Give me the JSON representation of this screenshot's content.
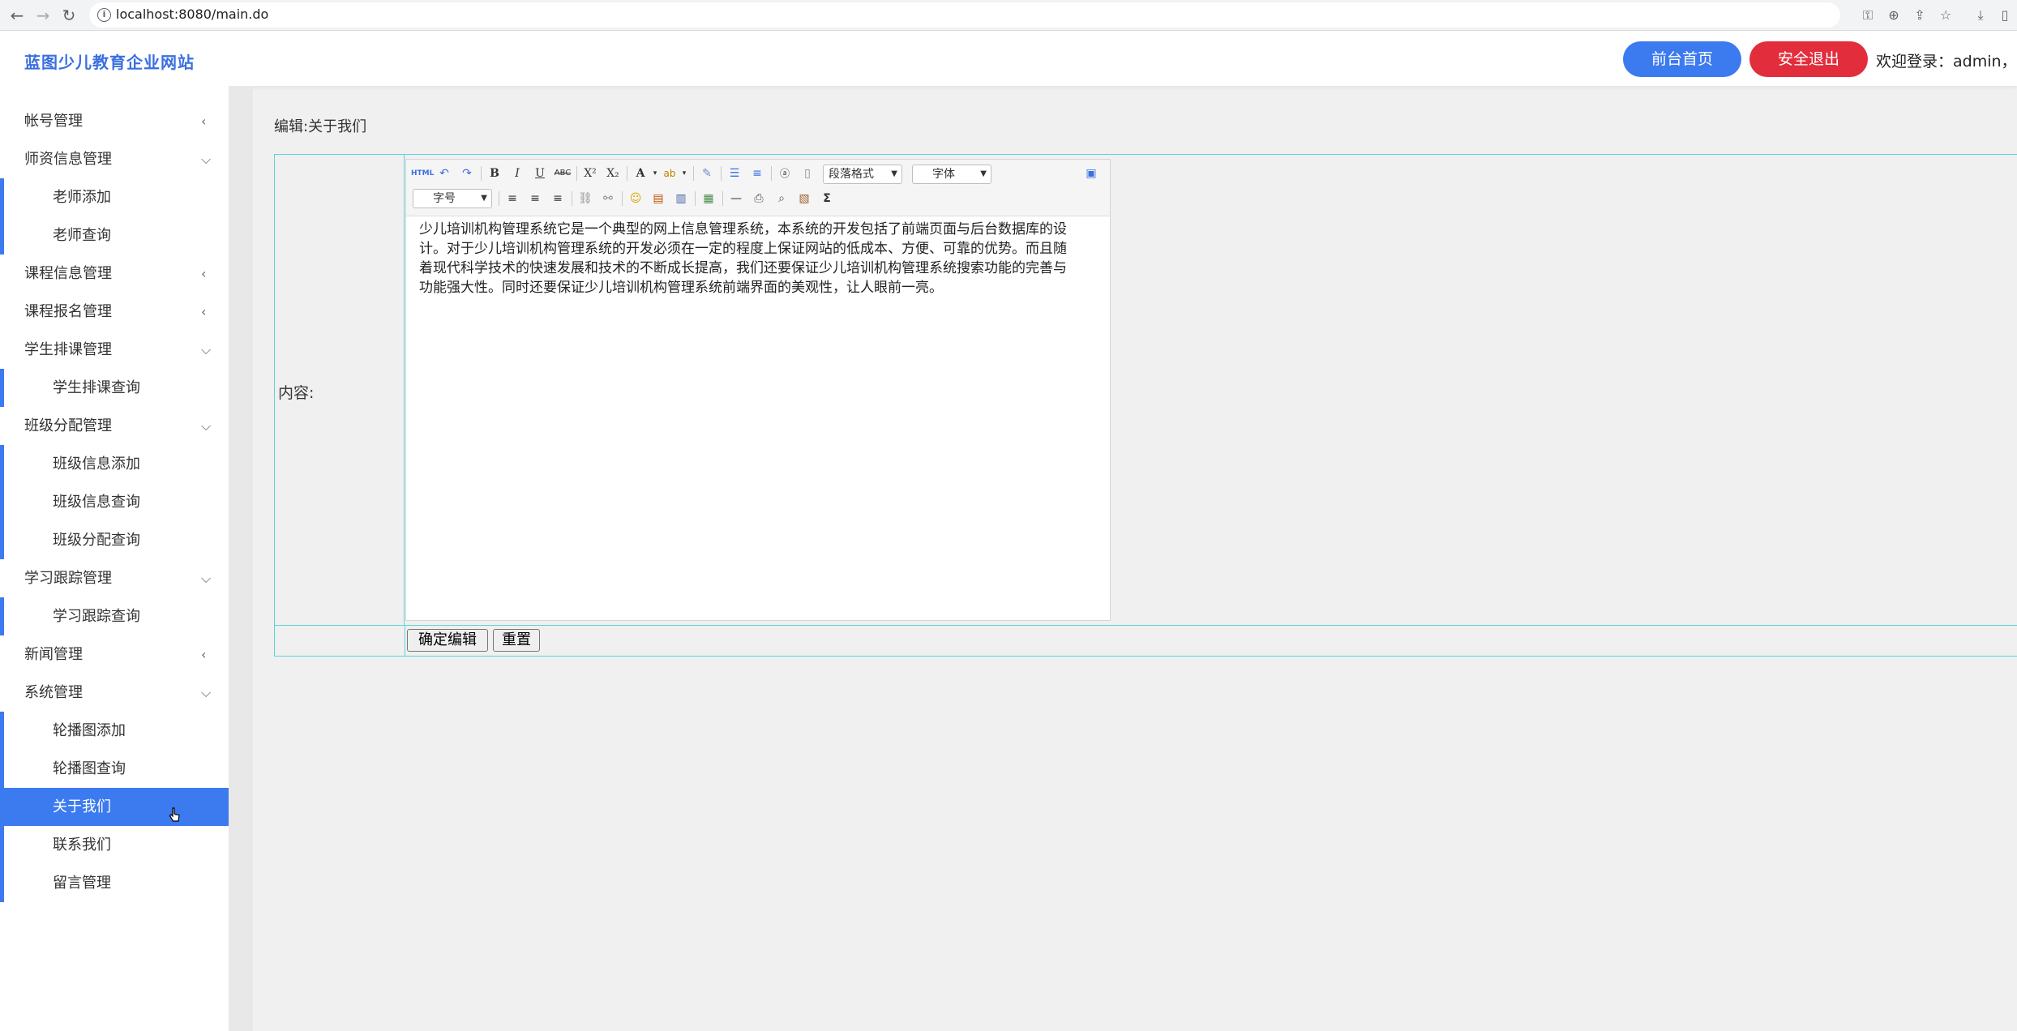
{
  "browser": {
    "url": "localhost:8080/main.do"
  },
  "header": {
    "brand": "蓝图少儿教育企业网站",
    "home_button": "前台首页",
    "logout_button": "安全退出",
    "welcome": "欢迎登录：admin，管"
  },
  "sidebar": {
    "items": [
      {
        "label": "帐号管理",
        "chevron": "left"
      },
      {
        "label": "师资信息管理",
        "chevron": "down",
        "children": [
          "老师添加",
          "老师查询"
        ]
      },
      {
        "label": "课程信息管理",
        "chevron": "left"
      },
      {
        "label": "课程报名管理",
        "chevron": "left"
      },
      {
        "label": "学生排课管理",
        "chevron": "down",
        "children": [
          "学生排课查询"
        ]
      },
      {
        "label": "班级分配管理",
        "chevron": "down",
        "children": [
          "班级信息添加",
          "班级信息查询",
          "班级分配查询"
        ]
      },
      {
        "label": "学习跟踪管理",
        "chevron": "down",
        "children": [
          "学习跟踪查询"
        ]
      },
      {
        "label": "新闻管理",
        "chevron": "left"
      },
      {
        "label": "系统管理",
        "chevron": "down",
        "children": [
          "轮播图添加",
          "轮播图查询",
          "关于我们",
          "联系我们",
          "留言管理"
        ]
      }
    ],
    "active": "关于我们"
  },
  "main": {
    "edit_title": "编辑:关于我们",
    "content_label": "内容:",
    "editor": {
      "select_paragraph": "段落格式",
      "select_font": "字体",
      "select_size": "字号",
      "html_label": "HTML",
      "body_text": "少儿培训机构管理系统它是一个典型的网上信息管理系统，本系统的开发包括了前端页面与后台数据库的设计。对于少儿培训机构管理系统的开发必须在一定的程度上保证网站的低成本、方便、可靠的优势。而且随着现代科学技术的快速发展和技术的不断成长提高，我们还要保证少儿培训机构管理系统搜索功能的完善与功能强大性。同时还要保证少儿培训机构管理系统前端界面的美观性，让人眼前一亮。"
    },
    "confirm_button": "确定编辑",
    "reset_button": "重置"
  },
  "colors": {
    "accent": "#3c7af0",
    "danger": "#e22e3c",
    "frame": "#5fd3d8"
  }
}
